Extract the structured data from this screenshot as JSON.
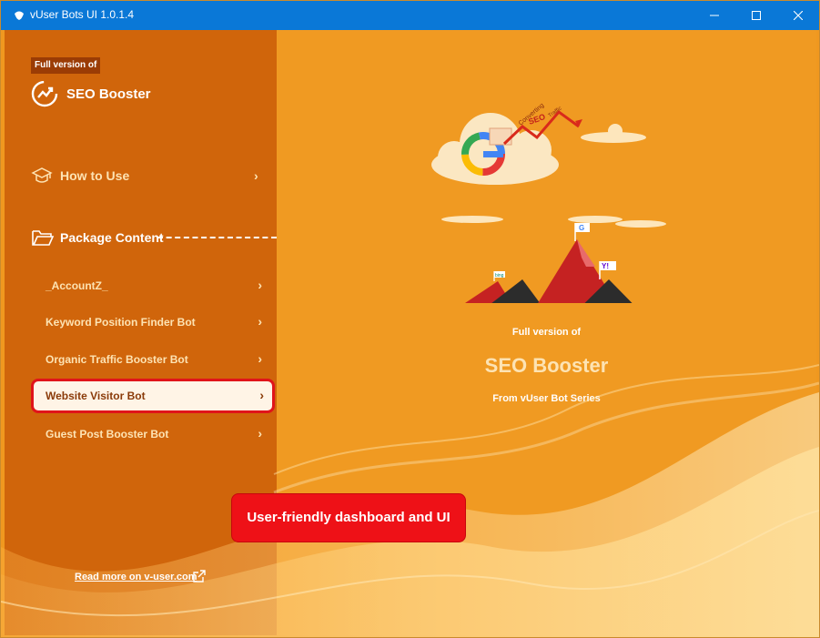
{
  "window": {
    "title": "vUser Bots UI 1.0.1.4",
    "minimize_icon": "minimize-icon",
    "maximize_icon": "maximize-icon",
    "close_icon": "close-icon"
  },
  "sidebar": {
    "badge": "Full version of",
    "brand": "SEO Booster",
    "how_to_use": "How to Use",
    "package_content": "Package Content",
    "items": [
      {
        "label": "_AccountZ_",
        "active": false
      },
      {
        "label": "Keyword Position Finder Bot",
        "active": false
      },
      {
        "label": "Organic Traffic Booster Bot",
        "active": false
      },
      {
        "label": "Website Visitor Bot",
        "active": true
      },
      {
        "label": "Guest Post Booster Bot",
        "active": false
      }
    ],
    "chevron": "›",
    "read_more": "Read more on v-user.com"
  },
  "main": {
    "full_version": "Full version of",
    "product": "SEO Booster",
    "series": "From vUser Bot Series",
    "callout": "User-friendly dashboard and UI",
    "illustration": {
      "arrow_words": [
        "Converting",
        "SEO",
        "Traffic"
      ],
      "flag_google": "G",
      "flag_yahoo": "Y!",
      "flag_bing": "bing"
    }
  },
  "colors": {
    "titlebar": "#0a78d7",
    "sidebar": "#d0650b",
    "main": "#f09a22",
    "accent_red": "#e0141a"
  }
}
